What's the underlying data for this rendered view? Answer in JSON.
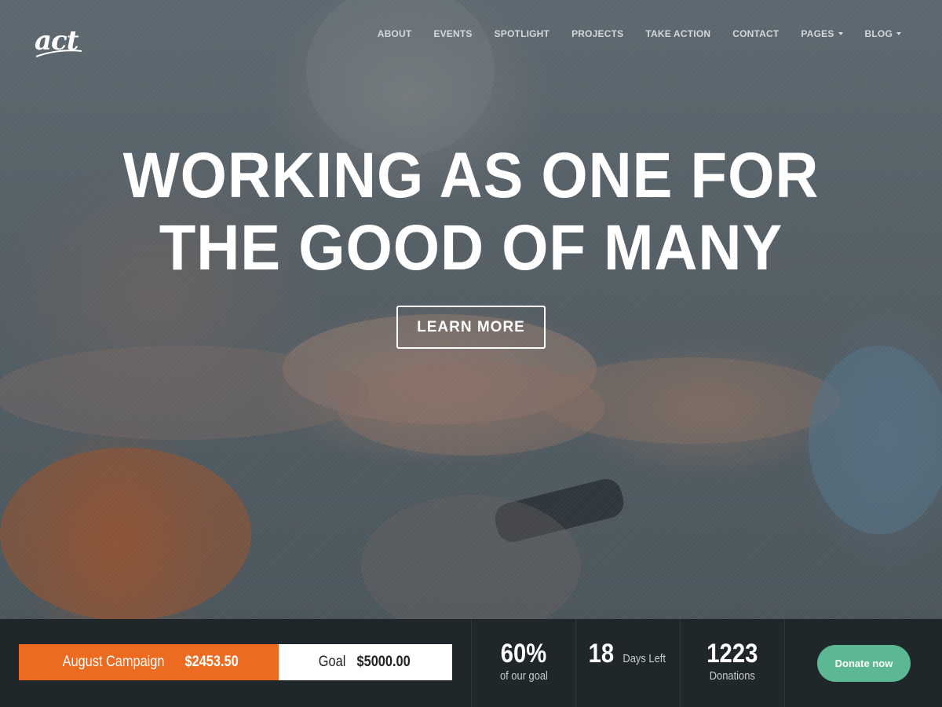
{
  "brand": {
    "logo_text": "act"
  },
  "nav": {
    "items": [
      {
        "label": "ABOUT",
        "dropdown": false
      },
      {
        "label": "EVENTS",
        "dropdown": false
      },
      {
        "label": "SPOTLIGHT",
        "dropdown": false
      },
      {
        "label": "PROJECTS",
        "dropdown": false
      },
      {
        "label": "TAKE ACTION",
        "dropdown": false
      },
      {
        "label": "CONTACT",
        "dropdown": false
      },
      {
        "label": "PAGES",
        "dropdown": true
      },
      {
        "label": "BLOG",
        "dropdown": true
      }
    ]
  },
  "hero": {
    "headline_line1": "WORKING AS ONE FOR",
    "headline_line2": "THE GOOD OF MANY",
    "cta_label": "LEARN MORE"
  },
  "campaign": {
    "name": "August Campaign",
    "raised": "$2453.50",
    "goal_label": "Goal",
    "goal_value": "$5000.00",
    "progress_fraction": 0.6
  },
  "stats": [
    {
      "value": "60%",
      "label": "of our goal"
    },
    {
      "value": "18",
      "label": "Days Left"
    },
    {
      "value": "1223",
      "label": "Donations"
    }
  ],
  "donate": {
    "label": "Donate now"
  },
  "colors": {
    "accent_orange": "#ec6b21",
    "donate_green": "#5cb894",
    "bar_bg": "#1f272b"
  }
}
